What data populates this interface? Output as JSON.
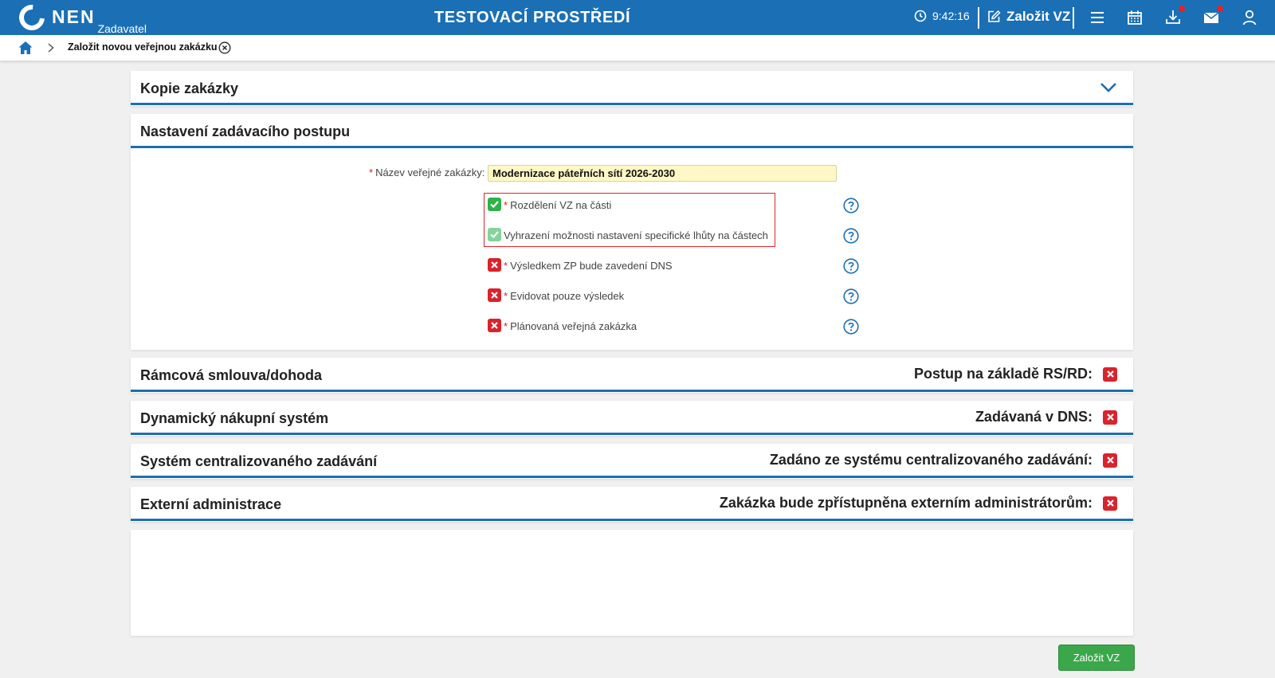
{
  "header": {
    "logo_text": "NEN",
    "logo_sub": "Zadavatel",
    "env_title": "TESTOVACÍ PROSTŘEDÍ",
    "clock": "9:42:16",
    "create_label": "Založit VZ",
    "icons": [
      "clock-icon",
      "edit-icon",
      "menu-icon",
      "calendar-icon",
      "download-icon",
      "mail-icon",
      "user-icon"
    ]
  },
  "breadcrumb": {
    "current": "Založit novou veřejnou zakázku"
  },
  "sections": {
    "copy": {
      "title": "Kopie zakázky"
    },
    "settings": {
      "title": "Nastavení zadávacího postupu"
    },
    "framework": {
      "title": "Rámcová smlouva/dohoda",
      "right_label": "Postup na základě RS/RD:",
      "value": false
    },
    "dns": {
      "title": "Dynamický nákupní systém",
      "right_label": "Zadávaná v DNS:",
      "value": false
    },
    "central": {
      "title": "Systém centralizovaného zadávání",
      "right_label": "Zadáno ze systému centralizovaného zadávání:",
      "value": false
    },
    "external": {
      "title": "Externí administrace",
      "right_label": "Zakázka bude zpřístupněna externím administrátorům:",
      "value": false
    }
  },
  "form": {
    "required_mark": "*",
    "name_label": "Název veřejné zakázky:",
    "name_value": "Modernizace páteřních sítí 2026-2030",
    "checkboxes": [
      {
        "label": "Rozdělení VZ na části",
        "required": true,
        "checked": true
      },
      {
        "label": "Vyhrazení možnosti nastavení specifické lhůty na částech",
        "required": false,
        "checked": true
      },
      {
        "label": "Výsledkem ZP bude zavedení DNS",
        "required": true,
        "checked": false
      },
      {
        "label": "Evidovat pouze výsledek",
        "required": true,
        "checked": false
      },
      {
        "label": "Plánovaná veřejná zakázka",
        "required": true,
        "checked": false
      }
    ]
  },
  "actions": {
    "submit_label": "Založit VZ"
  },
  "colors": {
    "primary": "#1b6fb5",
    "success": "#2eb24a",
    "danger": "#d9232d",
    "input_bg": "#fff8c6"
  }
}
